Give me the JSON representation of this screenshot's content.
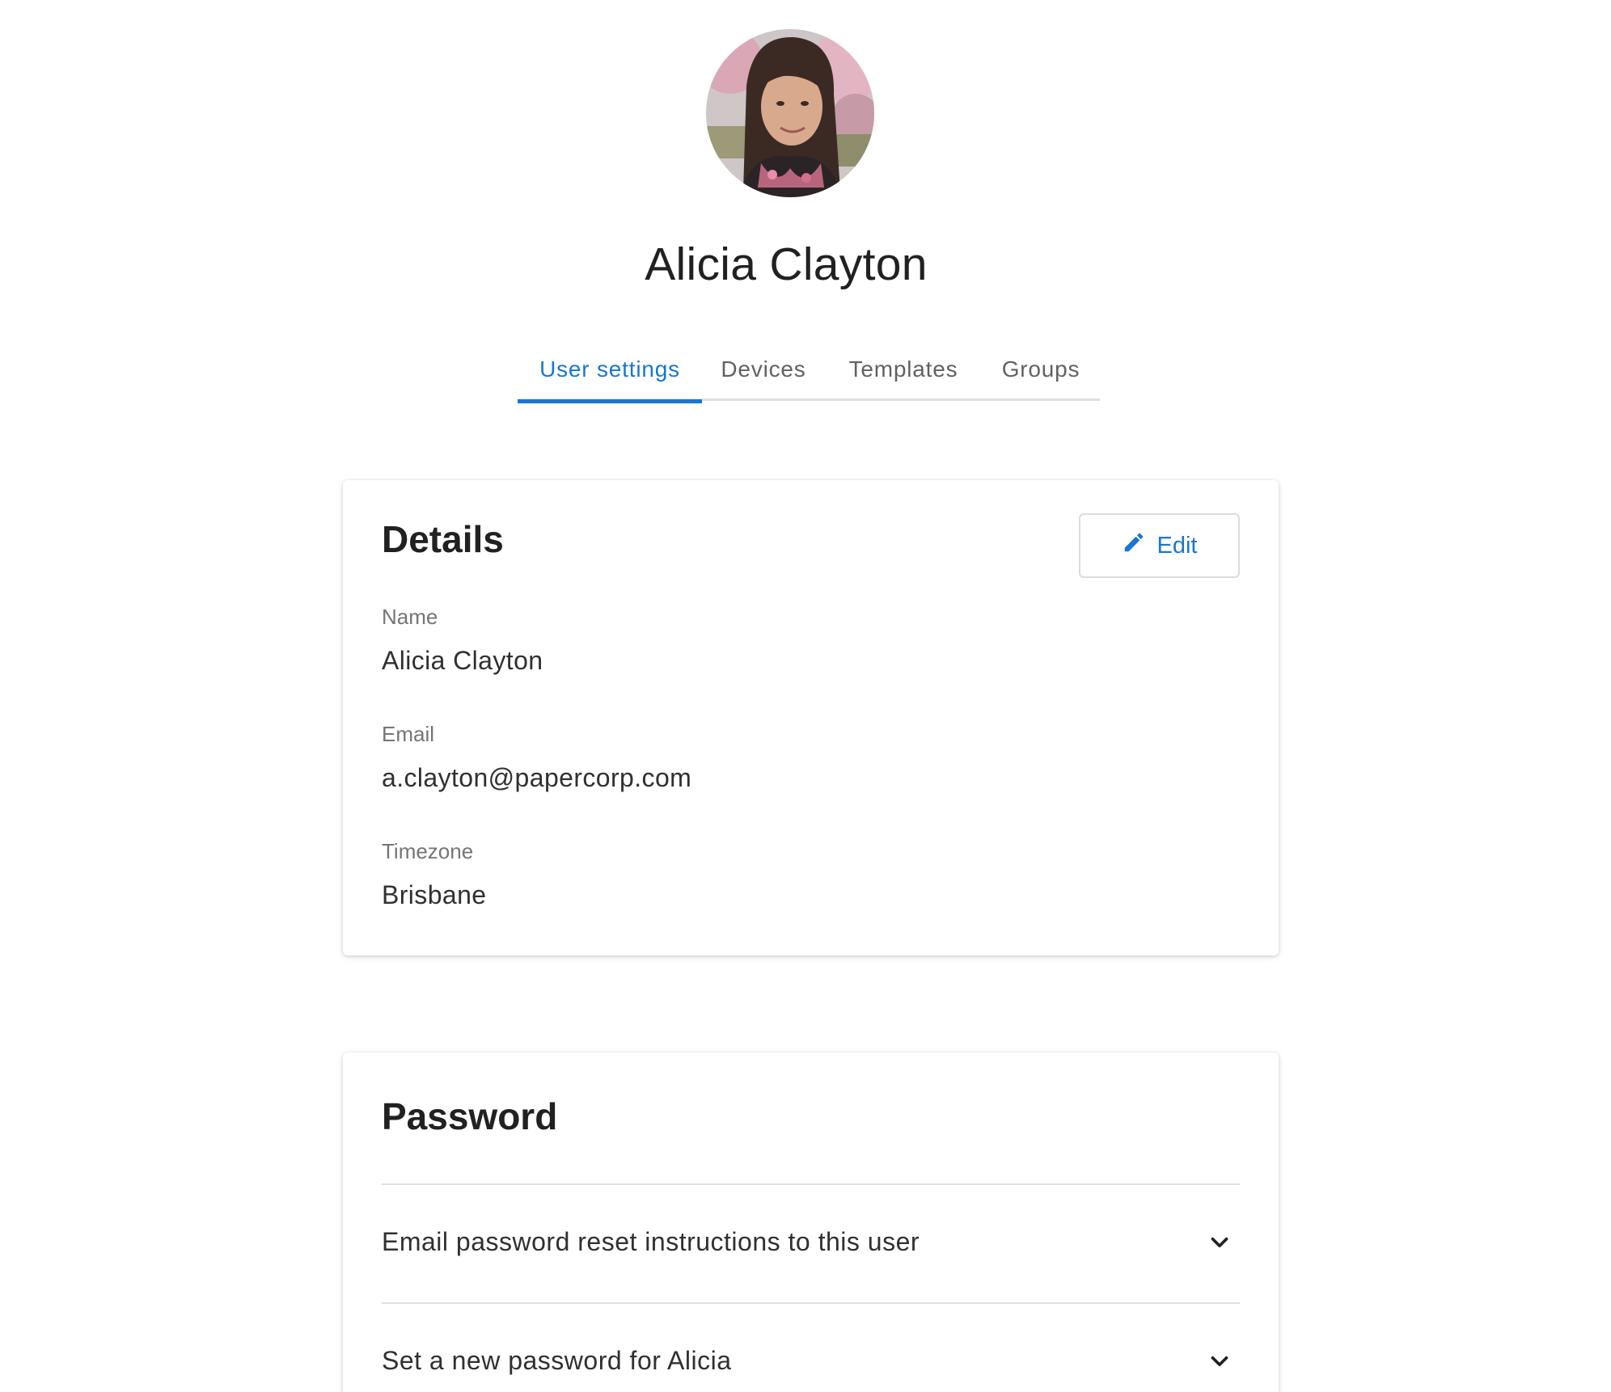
{
  "profile": {
    "name": "Alicia Clayton",
    "avatar_alt": "Alicia Clayton"
  },
  "tabs": [
    {
      "label": "User settings",
      "active": true
    },
    {
      "label": "Devices",
      "active": false
    },
    {
      "label": "Templates",
      "active": false
    },
    {
      "label": "Groups",
      "active": false
    }
  ],
  "details": {
    "title": "Details",
    "edit_label": "Edit",
    "fields": {
      "name": {
        "label": "Name",
        "value": "Alicia Clayton"
      },
      "email": {
        "label": "Email",
        "value": "a.clayton@papercorp.com"
      },
      "timezone": {
        "label": "Timezone",
        "value": "Brisbane"
      }
    }
  },
  "password": {
    "title": "Password",
    "options": [
      {
        "label": "Email password reset instructions to this user",
        "icon": "chevron-down-icon"
      },
      {
        "label": "Set a new password for Alicia",
        "icon": "chevron-down-icon"
      }
    ]
  },
  "colors": {
    "accent": "#1976d2",
    "tab_inactive": "#616161",
    "label": "#757575",
    "divider": "#e0e0e0"
  }
}
